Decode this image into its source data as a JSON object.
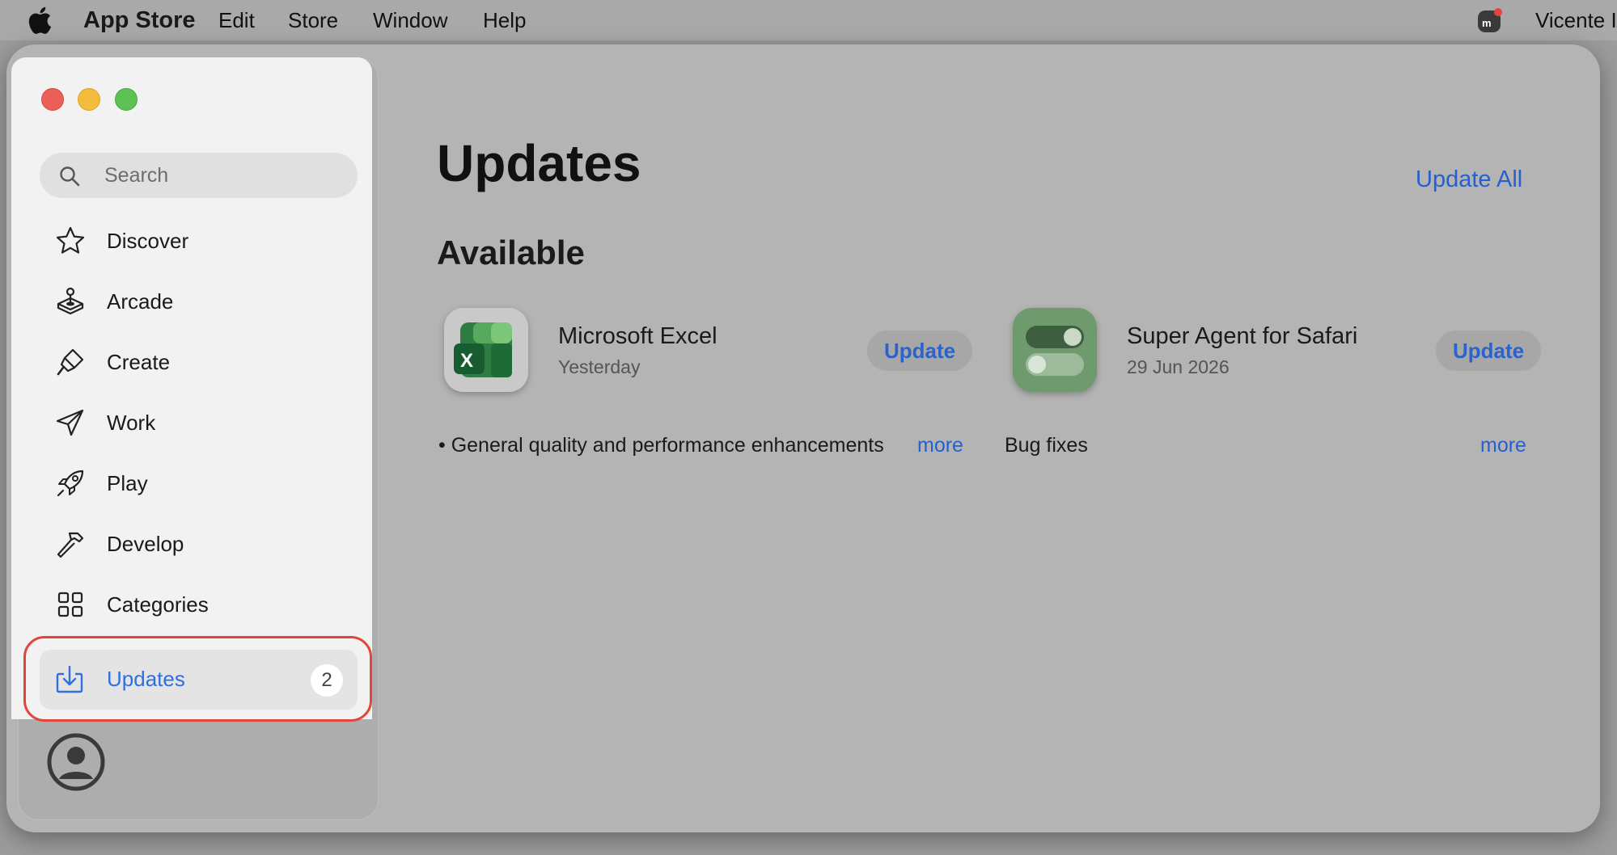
{
  "menubar": {
    "app_name": "App Store",
    "items": [
      "Edit",
      "Store",
      "Window",
      "Help"
    ],
    "user_name": "Vicente I"
  },
  "search": {
    "placeholder": "Search"
  },
  "sidebar": {
    "items": [
      {
        "label": "Discover",
        "icon": "star-icon"
      },
      {
        "label": "Arcade",
        "icon": "joystick-icon"
      },
      {
        "label": "Create",
        "icon": "paintbrush-icon"
      },
      {
        "label": "Work",
        "icon": "paperplane-icon"
      },
      {
        "label": "Play",
        "icon": "rocket-icon"
      },
      {
        "label": "Develop",
        "icon": "hammer-icon"
      },
      {
        "label": "Categories",
        "icon": "grid-icon"
      }
    ],
    "active": {
      "label": "Updates",
      "badge": "2",
      "icon": "download-tray-icon"
    }
  },
  "main": {
    "title": "Updates",
    "update_all": "Update All",
    "section": "Available",
    "apps": [
      {
        "name": "Microsoft Excel",
        "date": "Yesterday",
        "button": "Update",
        "notes": "• General quality and performance enhancements",
        "more": "more",
        "icon": "excel-icon"
      },
      {
        "name": "Super Agent for Safari",
        "date": "29 Jun 2026",
        "button": "Update",
        "notes": "Bug fixes",
        "more": "more",
        "icon": "toggle-switches-icon"
      }
    ]
  },
  "colors": {
    "accent": "#2460cf",
    "close": "#ec5f58",
    "minimize": "#f3bd3b",
    "maximize": "#5bc253",
    "focus_ring": "#e0463a"
  }
}
